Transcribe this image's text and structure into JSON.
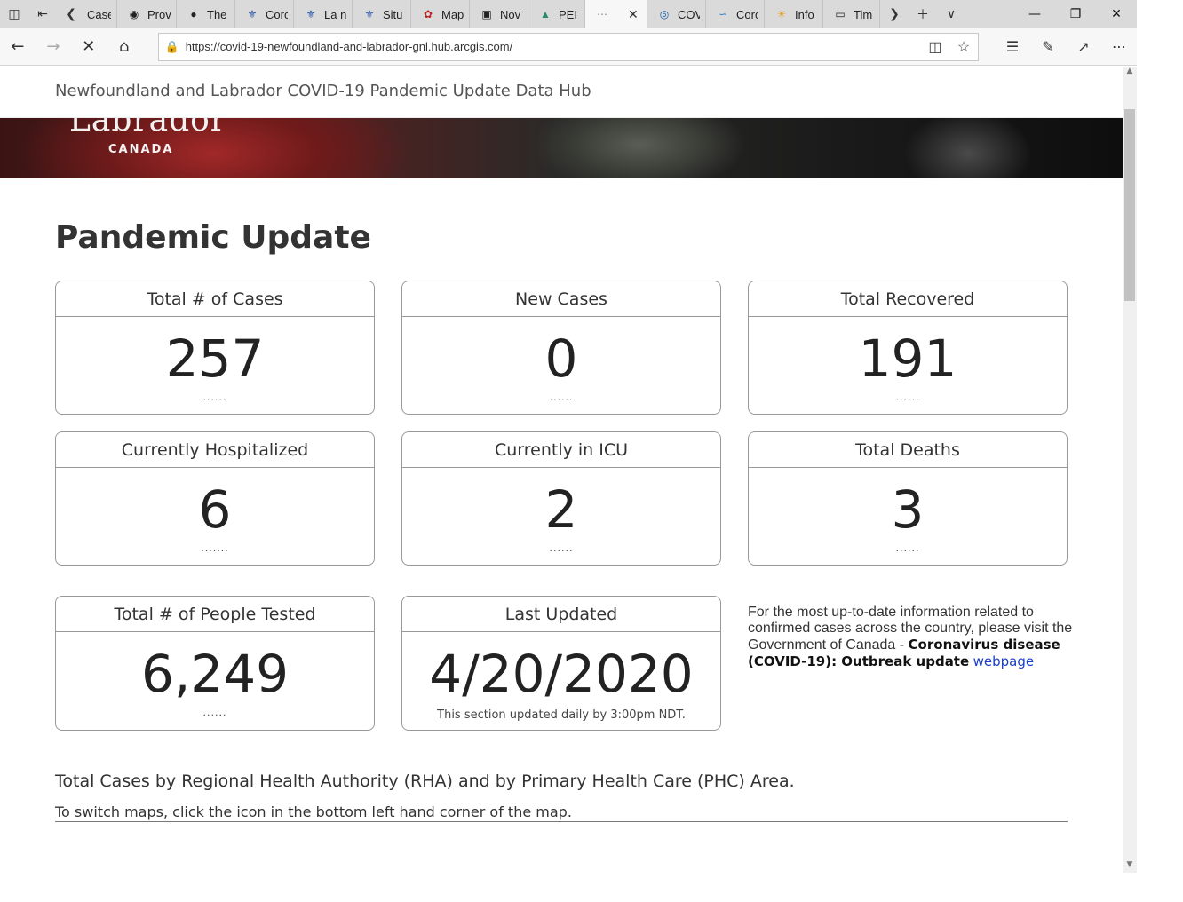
{
  "browser": {
    "tabs": [
      {
        "label": "Case",
        "icon": "page-icon"
      },
      {
        "label": "Prov",
        "icon": "moose-icon"
      },
      {
        "label": "The",
        "icon": "lion-icon"
      },
      {
        "label": "Corc",
        "icon": "fleur-de-lis-icon"
      },
      {
        "label": "La n",
        "icon": "fleur-de-lis-icon"
      },
      {
        "label": "Situ",
        "icon": "fleur-de-lis-icon"
      },
      {
        "label": "Map",
        "icon": "map-icon"
      },
      {
        "label": "Nov",
        "icon": "image-icon"
      },
      {
        "label": "PEI (",
        "icon": "pei-icon"
      },
      {
        "label": "",
        "icon": "loading-icon",
        "active": true
      },
      {
        "label": "COV",
        "icon": "globe-icon"
      },
      {
        "label": "Corc",
        "icon": "wave-icon"
      },
      {
        "label": "Info",
        "icon": "sun-icon"
      },
      {
        "label": "Tim",
        "icon": "window-icon"
      }
    ],
    "url": "https://covid-19-newfoundland-and-labrador-gnl.hub.arcgis.com/"
  },
  "site": {
    "header_title": "Newfoundland and Labrador COVID-19 Pandemic Update Data Hub",
    "banner_logo_main": "Labrador",
    "banner_logo_sub": "CANADA"
  },
  "page": {
    "title": "Pandemic Update",
    "cards": [
      {
        "label": "Total # of Cases",
        "value": "257",
        "foot": "......"
      },
      {
        "label": "New Cases",
        "value": "0",
        "foot": "......"
      },
      {
        "label": "Total Recovered",
        "value": "191",
        "foot": "......"
      },
      {
        "label": "Currently Hospitalized",
        "value": "6",
        "foot": "......."
      },
      {
        "label": "Currently in ICU",
        "value": "2",
        "foot": "......"
      },
      {
        "label": "Total Deaths",
        "value": "3",
        "foot": "......"
      },
      {
        "label": "Total # of People Tested",
        "value": "6,249",
        "foot": "......"
      },
      {
        "label": "Last Updated",
        "value": "4/20/2020",
        "foot": "This section updated daily by 3:00pm NDT."
      }
    ],
    "info_text": "For the most up-to-date information related to confirmed cases across the country, please visit the Government of Canada - ",
    "info_bold": "Coronavirus disease (COVID-19): Outbreak update",
    "info_link": "webpage",
    "rha_title": "Total Cases by Regional Health Authority (RHA) and by Primary Health Care (PHC) Area.",
    "rha_note": "To switch maps, click the icon in the bottom left hand corner of the map."
  }
}
